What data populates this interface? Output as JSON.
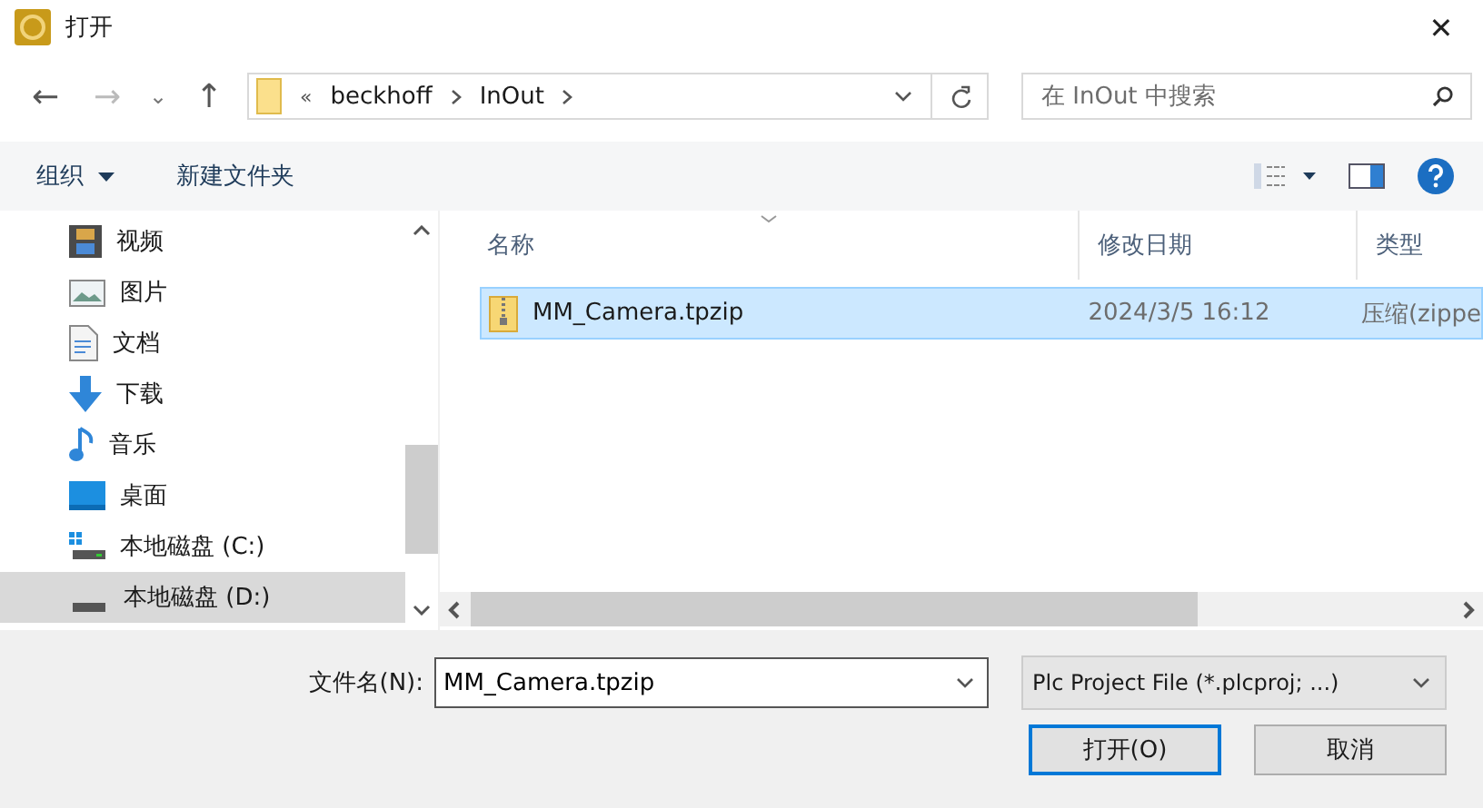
{
  "window": {
    "title": "打开",
    "close": "✕"
  },
  "nav": {
    "back": "←",
    "forward": "→",
    "recent": "⌄",
    "up": "↑",
    "breadcrumb": [
      {
        "label": "«",
        "kind": "overflow"
      },
      {
        "label": "beckhoff",
        "kind": "folder"
      },
      {
        "label": "InOut",
        "kind": "folder"
      }
    ],
    "search": {
      "placeholder": "在 InOut 中搜索"
    }
  },
  "toolbar": {
    "organize": "组织",
    "new_folder": "新建文件夹"
  },
  "sidebar": {
    "items": [
      {
        "label": "视频",
        "kind": "video",
        "selected": false
      },
      {
        "label": "图片",
        "kind": "pictures",
        "selected": false
      },
      {
        "label": "文档",
        "kind": "documents",
        "selected": false
      },
      {
        "label": "下载",
        "kind": "downloads",
        "selected": false
      },
      {
        "label": "音乐",
        "kind": "music",
        "selected": false
      },
      {
        "label": "桌面",
        "kind": "desktop",
        "selected": false
      },
      {
        "label": "本地磁盘 (C:)",
        "kind": "system-drive",
        "selected": false
      },
      {
        "label": "本地磁盘 (D:)",
        "kind": "drive",
        "selected": true
      }
    ]
  },
  "table": {
    "columns": [
      "名称",
      "修改日期",
      "类型"
    ],
    "rows": [
      {
        "name": "MM_Camera.tpzip",
        "modified": "2024/3/5 16:12",
        "type": "压缩(zippe",
        "selected": true
      }
    ]
  },
  "footer": {
    "filename_label": "文件名(N):",
    "filename": "MM_Camera.tpzip",
    "filter": "Plc Project File (*.plcproj; ...)",
    "buttons": [
      {
        "label": "打开(O)",
        "kind": "primary"
      },
      {
        "label": "取消",
        "kind": "normal"
      }
    ]
  }
}
